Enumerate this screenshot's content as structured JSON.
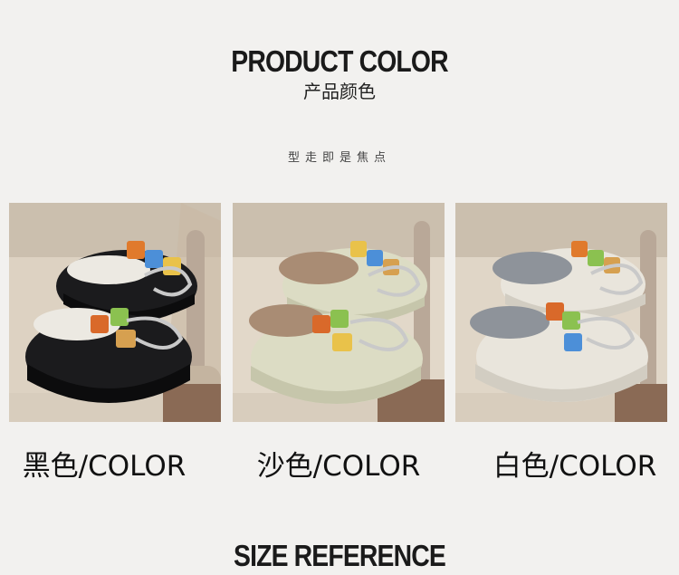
{
  "header": {
    "title": "PRODUCT COLOR",
    "subtitle": "产品颜色",
    "tagline": "型走即是焦点"
  },
  "variants": [
    {
      "caption": "黑色/COLOR",
      "shoe_color": "#1b1b1d",
      "lining_color": "#ece9e2"
    },
    {
      "caption": "沙色/COLOR",
      "shoe_color": "#dcdcc4",
      "lining_color": "#a98c74"
    },
    {
      "caption": "白色/COLOR",
      "shoe_color": "#e9e5dc",
      "lining_color": "#8e939a"
    }
  ],
  "footer": {
    "title": "SIZE REFERENCE"
  }
}
